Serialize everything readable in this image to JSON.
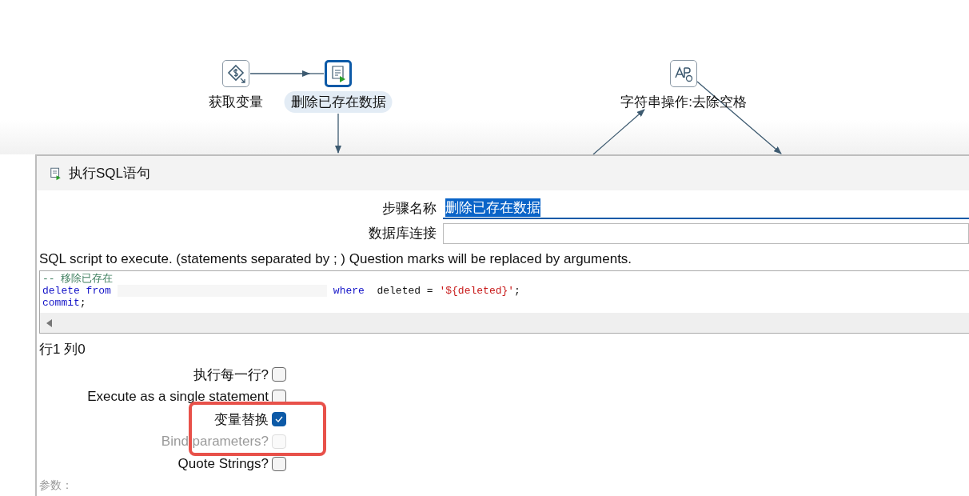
{
  "canvas": {
    "nodes": [
      {
        "kind": "variable",
        "label": "获取变量",
        "selected": false
      },
      {
        "kind": "sql",
        "label": "删除已存在数据",
        "selected": true
      },
      {
        "kind": "string",
        "label": "字符串操作:去除空格",
        "selected": false
      }
    ]
  },
  "dialog": {
    "title": "执行SQL语句",
    "fields": [
      {
        "label": "步骤名称",
        "value": "删除已存在数据",
        "selected": true
      },
      {
        "label": "数据库连接",
        "selected": false
      }
    ],
    "sql_label": "SQL script to execute. (statements separated by ; ) Question marks will be replaced by arguments.",
    "sql_lines": [
      [
        {
          "kind": "comment",
          "text": "-- 移除已存在"
        }
      ],
      [
        {
          "kind": "keyword",
          "text": "delete from"
        },
        {
          "kind": "redacted"
        },
        {
          "kind": "keyword",
          "text": "where"
        },
        {
          "kind": "plain",
          "text": "  deleted = "
        },
        {
          "kind": "string",
          "text": "'${deleted}'"
        },
        {
          "kind": "plain",
          "text": ";"
        }
      ],
      [
        {
          "kind": "keyword",
          "text": "commit"
        },
        {
          "kind": "plain",
          "text": ";"
        }
      ]
    ],
    "cursor": "行1 列0",
    "options": [
      {
        "label": "执行每一行?",
        "checked": false,
        "disabled": false
      },
      {
        "label": "Execute as a single statement",
        "checked": false,
        "disabled": false
      },
      {
        "label": "变量替换",
        "checked": true,
        "disabled": false
      },
      {
        "label": "Bind parameters?",
        "checked": false,
        "disabled": true
      },
      {
        "label": "Quote Strings?",
        "checked": false,
        "disabled": false
      }
    ],
    "params_label": "参数："
  }
}
